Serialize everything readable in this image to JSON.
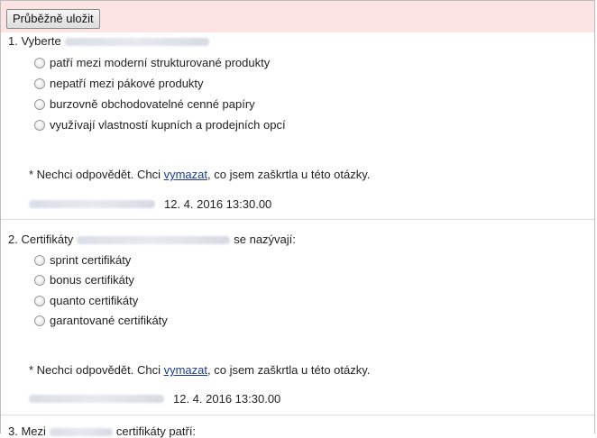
{
  "toolbar": {
    "save_label": "Průběžně uložit"
  },
  "questions": [
    {
      "title_prefix": "1. Vyberte",
      "title_suffix": "",
      "options": [
        "patří mezi moderní strukturované produkty",
        "nepatří mezi pákové produkty",
        "burzovně obchodovatelné cenné papíry",
        "využívají vlastností kupních a prodejních opcí"
      ],
      "note_before": "* Nechci odpovědět. Chci ",
      "note_link": "vymazat",
      "note_after": ", co jsem zaškrtla u této otázky.",
      "timestamp": "12. 4. 2016 13:30.00"
    },
    {
      "title_prefix": "2. Certifikáty",
      "title_suffix": "se nazývají:",
      "options": [
        "sprint certifikáty",
        "bonus certifikáty",
        "quanto certifikáty",
        "garantované certifikáty"
      ],
      "note_before": "* Nechci odpovědět. Chci ",
      "note_link": "vymazat",
      "note_after": ", co jsem zaškrtla u této otázky.",
      "timestamp": "12. 4. 2016 13:30.00"
    },
    {
      "title_prefix": "3. Mezi",
      "title_suffix": "certifikáty patří:"
    }
  ]
}
